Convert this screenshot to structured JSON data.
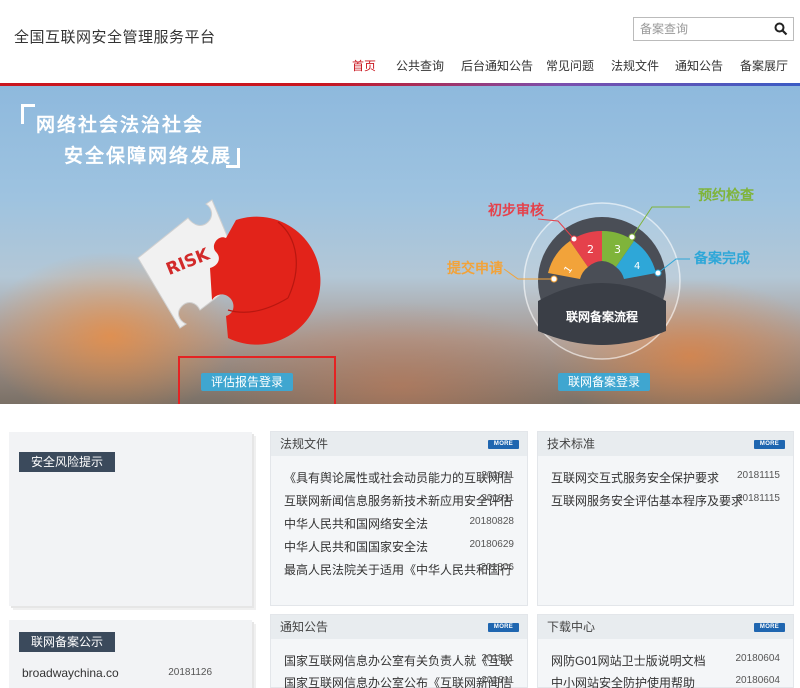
{
  "header": {
    "title": "全国互联网安全管理服务平台",
    "search_placeholder": "备案查询",
    "nav": [
      "首页",
      "公共查询",
      "后台通知公告",
      "常见问题",
      "法规文件",
      "通知公告",
      "备案展厅"
    ]
  },
  "banner": {
    "slogan_line1": "网络社会法治社会",
    "slogan_line2": "安全保障网络发展",
    "puzzle_text": "RISK",
    "assess_login": "评估报告登录",
    "flow_title": "联网备案流程",
    "flow_steps": [
      "提交申请",
      "初步审核",
      "预约检查",
      "备案完成"
    ],
    "flow_numbers": [
      "1",
      "2",
      "3",
      "4"
    ],
    "record_login": "联网备案登录"
  },
  "side": {
    "risk_title": "安全风险提示",
    "record_title": "联网备案公示",
    "record_items": [
      {
        "title": "broadwaychina.co",
        "date": "20181126"
      }
    ]
  },
  "panels": {
    "more_label": "MORE",
    "regulations": {
      "title": "法规文件",
      "items": [
        {
          "title": "《具有舆论属性或社会动员能力的互联网信",
          "date": "201811"
        },
        {
          "title": "互联网新闻信息服务新技术新应用安全评估",
          "date": "201811"
        },
        {
          "title": "中华人民共和国网络安全法",
          "date": "20180828"
        },
        {
          "title": "中华人民共和国国家安全法",
          "date": "20180629"
        },
        {
          "title": "最高人民法院关于适用《中华人民共和国行",
          "date": "201806"
        }
      ]
    },
    "standards": {
      "title": "技术标准",
      "items": [
        {
          "title": "互联网交互式服务安全保护要求",
          "date": "20181115"
        },
        {
          "title": "互联网服务安全评估基本程序及要求",
          "date": "20181115"
        }
      ]
    },
    "notices": {
      "title": "通知公告",
      "items": [
        {
          "title": "国家互联网信息办公室有关负责人就《互联",
          "date": "201811"
        },
        {
          "title": "国家互联网信息办公室公布《互联网新闻信",
          "date": "201811"
        }
      ]
    },
    "downloads": {
      "title": "下载中心",
      "items": [
        {
          "title": "网防G01网站卫士版说明文档",
          "date": "20180604"
        },
        {
          "title": "中小网站安全防护使用帮助",
          "date": "20180604"
        }
      ]
    }
  },
  "colors": {
    "accent_red": "#c9151e",
    "button_blue": "#3fa6d0",
    "more_blue": "#1f66b0",
    "tag_dark": "#3b4a5c"
  }
}
